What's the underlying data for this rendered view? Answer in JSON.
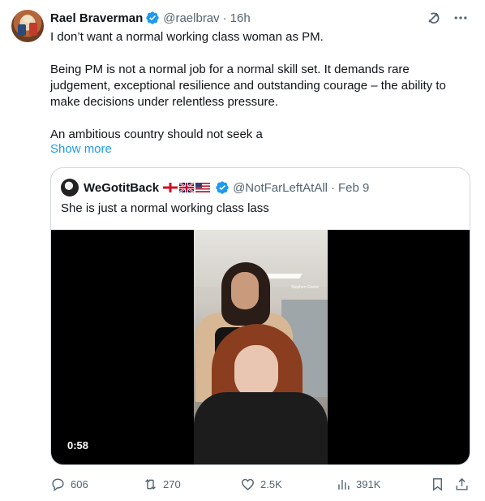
{
  "post": {
    "author_name": "Rael Braverman",
    "author_handle": "@raelbrav",
    "separator": "·",
    "timestamp": "16h",
    "paragraphs": [
      "I don’t want a normal working class woman as PM.",
      "Being PM is not a normal job for a normal skill set. It demands rare judgement, exceptional resilience and outstanding courage – the ability to make decisions under relentless pressure.",
      "An ambitious country should not seek a"
    ],
    "show_more": "Show more",
    "icons": {
      "verified": "verified-badge-icon",
      "grok": "grok-icon",
      "more": "more-icon"
    },
    "accent_color": "#1d9bf0"
  },
  "quote": {
    "author_name": "WeGotitBack",
    "flags": [
      "england-flag",
      "uk-flag",
      "us-flag"
    ],
    "author_handle": "@NotFarLeftAtAll",
    "separator": "·",
    "timestamp": "Feb 9",
    "text": "She is just a normal working class lass",
    "video": {
      "duration": "0:58",
      "overlay_text": "Stephen Gorrie"
    }
  },
  "actions": {
    "replies": "606",
    "retweets": "270",
    "likes": "2.5K",
    "views": "391K",
    "icons": [
      "reply-icon",
      "retweet-icon",
      "like-icon",
      "views-icon",
      "bookmark-icon",
      "share-icon"
    ]
  }
}
